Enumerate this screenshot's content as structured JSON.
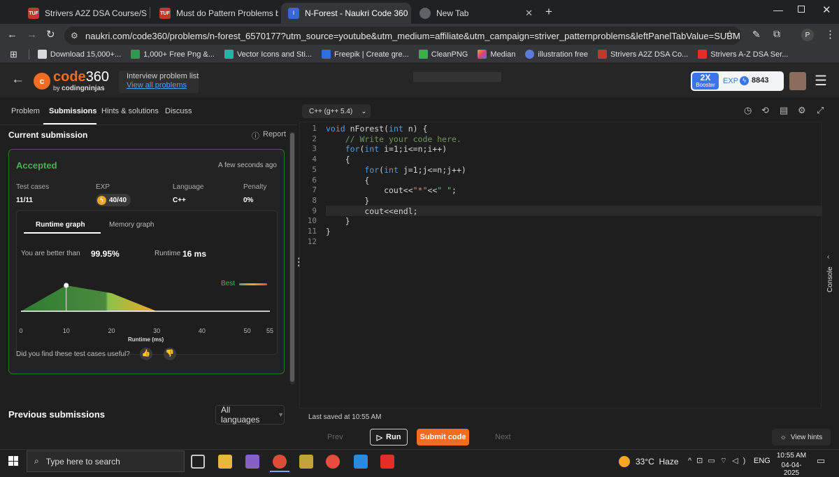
{
  "browser": {
    "tabs": [
      {
        "title": "Strivers A2Z DSA Course/Sheet",
        "favicon": "tuf-icon"
      },
      {
        "title": "Must do Pattern Problems befo",
        "favicon": "tuf-icon"
      },
      {
        "title": "N-Forest - Naukri Code 360",
        "favicon": "codingninjas-icon"
      },
      {
        "title": "New Tab",
        "favicon": "chrome-icon"
      }
    ],
    "url": "naukri.com/code360/problems/n-forest_6570177?utm_source=youtube&utm_medium=affiliate&utm_campaign=striver_patternproblems&leftPanelTabValue=SUBMISSION",
    "profile_initial": "P",
    "bookmarks": [
      "Download 15,000+...",
      "1,000+ Free Png &...",
      "Vector Icons and Sti...",
      "Freepik | Create gre...",
      "CleanPNG",
      "Median",
      "illustration free",
      "Strivers A2Z DSA Co...",
      "Strivers A-Z DSA Ser..."
    ]
  },
  "header": {
    "logo_main": "code",
    "logo_num": "360",
    "logo_sub_by": "by",
    "logo_sub": "codingninjas",
    "list_label": "Interview problem list",
    "list_link": "View all problems",
    "booster_x": "2X",
    "booster_label": "Booster",
    "exp_label": "EXP",
    "exp_value": "8843"
  },
  "left_tabs": [
    "Problem",
    "Submissions",
    "Hints & solutions",
    "Discuss"
  ],
  "submission": {
    "title": "Current submission",
    "report": "Report",
    "status": "Accepted",
    "time": "A few seconds ago",
    "cols": [
      {
        "label": "Test cases",
        "value": "11/11"
      },
      {
        "label": "EXP",
        "value": "40/40"
      },
      {
        "label": "Language",
        "value": "C++"
      },
      {
        "label": "Penalty",
        "value": "0%"
      }
    ],
    "graph_tabs": [
      "Runtime graph",
      "Memory graph"
    ],
    "better_label": "You are better than",
    "better_value": "99.95%",
    "runtime_label": "Runtime",
    "runtime_value": "16 ms",
    "best_label": "Best",
    "x_label": "Runtime (ms)",
    "x_ticks": [
      "0",
      "10",
      "20",
      "30",
      "40",
      "50",
      "55"
    ],
    "feedback_q": "Did you find these test cases useful?",
    "previous_title": "Previous submissions",
    "lang_filter": "All languages"
  },
  "chart_data": {
    "type": "area",
    "x": [
      0,
      10,
      20,
      30,
      55
    ],
    "y": [
      0,
      1.0,
      0.7,
      0,
      0
    ],
    "xlim": [
      0,
      55
    ],
    "highlight_x": 10,
    "xlabel": "Runtime (ms)",
    "ylabel": "",
    "title": ""
  },
  "editor": {
    "language": "C++ (g++ 5.4)",
    "lines": [
      "void nForest(int n) {",
      "    // Write your code here.",
      "    for(int i=1;i<=n;i++)",
      "    {",
      "        for(int j=1;j<=n;j++)",
      "        {",
      "            cout<<\"*\"<<\" \";",
      "        }",
      "        cout<<endl;",
      "    }",
      "}",
      ""
    ],
    "last_saved": "Last saved at 10:55 AM",
    "console_label": "Console"
  },
  "bottom": {
    "prev": "Prev",
    "run": "Run",
    "submit": "Submit code",
    "next": "Next",
    "hints": "View hints"
  },
  "taskbar": {
    "search_placeholder": "Type here to search",
    "weather": "33°C  Haze",
    "lang": "ENG",
    "time": "10:55 AM",
    "date": "04-04-2025"
  },
  "colors": {
    "accent": "#f26d21",
    "accepted": "#4caf50",
    "exp_badge": "#3a74e8"
  }
}
